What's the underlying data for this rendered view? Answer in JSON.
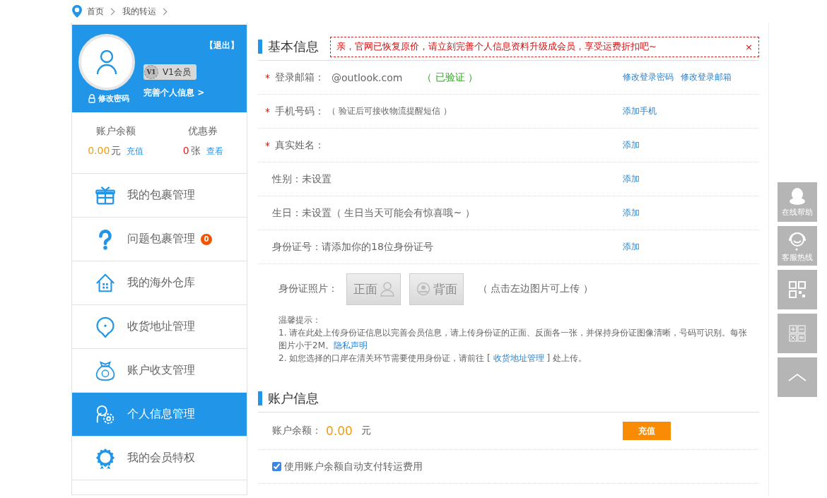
{
  "breadcrumb": [
    "首页",
    "我的转运"
  ],
  "profile": {
    "logout": "【退出】",
    "level_badge": "V1",
    "level_name": "V1会员",
    "complete_link": "完善个人信息 >",
    "change_password": "修改密码"
  },
  "stats": [
    {
      "title": "账户余额",
      "value": "0.00",
      "unit": "元",
      "link": "充值",
      "kind": "balance"
    },
    {
      "title": "优惠券",
      "value": "0",
      "unit": " 张",
      "link": "查看",
      "kind": "coupon"
    }
  ],
  "menu": [
    {
      "label": "我的包裹管理",
      "selected": false
    },
    {
      "label": "问题包裹管理",
      "selected": false,
      "badge": "0"
    },
    {
      "label": "我的海外仓库",
      "selected": false
    },
    {
      "label": "收货地址管理",
      "selected": false
    },
    {
      "label": "账户收支管理",
      "selected": false
    },
    {
      "label": "个人信息管理",
      "selected": true
    },
    {
      "label": "我的会员特权",
      "selected": false
    }
  ],
  "basic_info": {
    "title": "基本信息",
    "notice": {
      "text": "亲，官网已恢复原价，请立刻完善个人信息资料升级成会员，享受运费折扣吧~",
      "close": "×"
    },
    "rows": [
      {
        "kind": "field",
        "mark": "*",
        "label": "登录邮箱：",
        "value": "@outlook.com",
        "status": "（ 已验证 ）",
        "actions": [
          "修改登录密码",
          "修改登录邮箱"
        ]
      },
      {
        "kind": "field",
        "mark": "*",
        "label": "手机号码：",
        "hint": "（ 验证后可接收物流提醒短信 ）",
        "actions": [
          "添加手机"
        ]
      },
      {
        "kind": "field",
        "mark": "*",
        "label": "真实姓名：",
        "actions": [
          "添加"
        ]
      },
      {
        "kind": "field",
        "label": "性别：未设置",
        "actions": [
          "添加"
        ]
      },
      {
        "kind": "field",
        "label": "生日：未设置（ 生日当天可能会有惊喜哦~ ）",
        "actions": [
          "添加"
        ]
      },
      {
        "kind": "field",
        "label": "身份证号：请添加你的18位身份证号",
        "actions": [
          "添加"
        ]
      },
      {
        "kind": "photos",
        "label": "身份证照片：",
        "photos": [
          "正面",
          "背面"
        ],
        "hint": "（  点击左边图片可上传 ）"
      }
    ],
    "tips": {
      "title": "温馨提示：",
      "items": [
        {
          "before": "1. 请在此处上传身份证信息以完善会员信息，请上传身份证的正面、反面各一张，并保持身份证图像清晰，号码可识别。每张图片小于2M。",
          "link": "隐私声明"
        },
        {
          "before": "2. 如您选择的口岸在清关环节需要使用身份证，请前往 [ ",
          "link": "收货地址管理",
          "after": " ] 处上传。"
        }
      ]
    }
  },
  "account_info": {
    "title": "账户信息",
    "balance_label": "账户余额：",
    "balance": "0.00",
    "unit": "元",
    "button": "充值",
    "auto_pay": {
      "label": "使用账户余额自动支付转运费用",
      "checked": true
    }
  },
  "side_tools": [
    {
      "kind": "help",
      "label": "在线帮助"
    },
    {
      "kind": "hotline",
      "label": "客服热线"
    },
    {
      "kind": "qr"
    },
    {
      "kind": "calculator"
    },
    {
      "kind": "top"
    }
  ]
}
